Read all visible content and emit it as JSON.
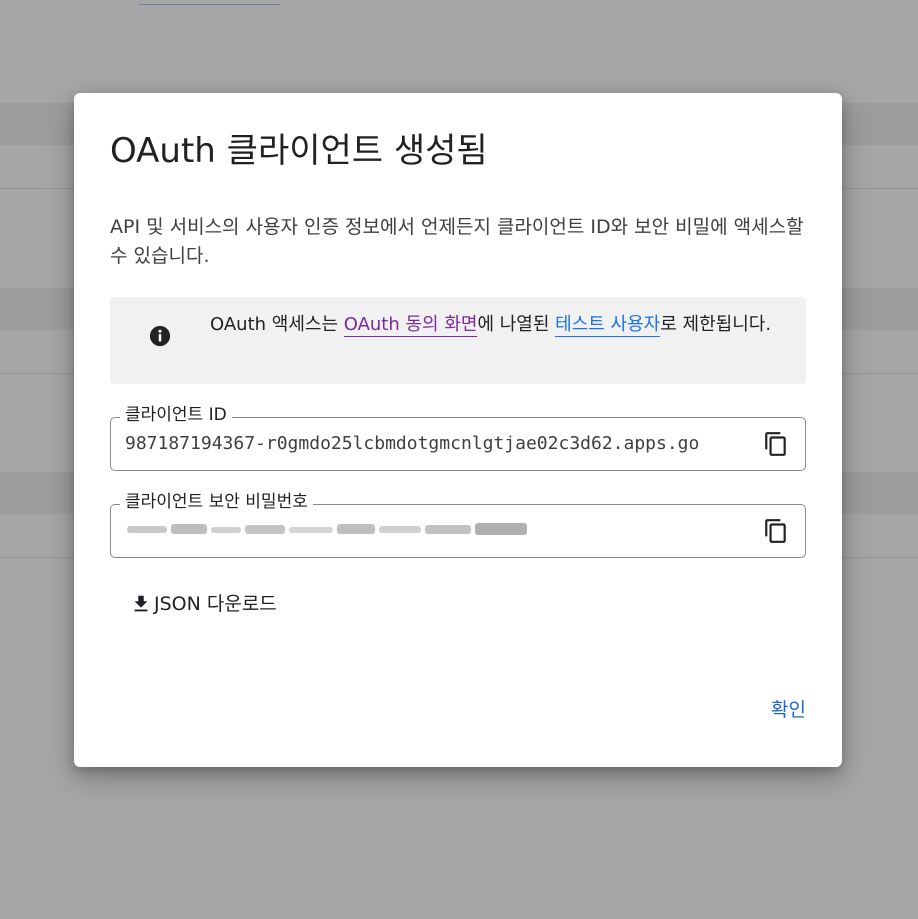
{
  "dialog": {
    "title": "OAuth 클라이언트 생성됨",
    "description": "API 및 서비스의 사용자 인증 정보에서 언제든지 클라이언트 ID와 보안 비밀에 액세스할 수 있습니다.",
    "info": {
      "icon": "info-icon",
      "text_before": "OAuth 액세스는 ",
      "consent_link": "OAuth 동의 화면",
      "text_middle": "에 나열된 ",
      "test_users_link": "테스트 사용자",
      "text_after": "로 제한됩니다."
    },
    "client_id": {
      "label": "클라이언트 ID",
      "value": "987187194367-r0gmdo25lcbmdotgmcnlgtjae02c3d62.apps.go",
      "copy_icon": "copy-icon"
    },
    "client_secret": {
      "label": "클라이언트 보안 비밀번호",
      "copy_icon": "copy-icon"
    },
    "download": {
      "label": "JSON 다운로드",
      "icon": "download-icon"
    },
    "ok_button": "확인"
  },
  "colors": {
    "overlay": "#a6a6a6",
    "link_visited": "#7b2c9e",
    "link": "#1a73e8",
    "primary_button": "#1967d2"
  }
}
